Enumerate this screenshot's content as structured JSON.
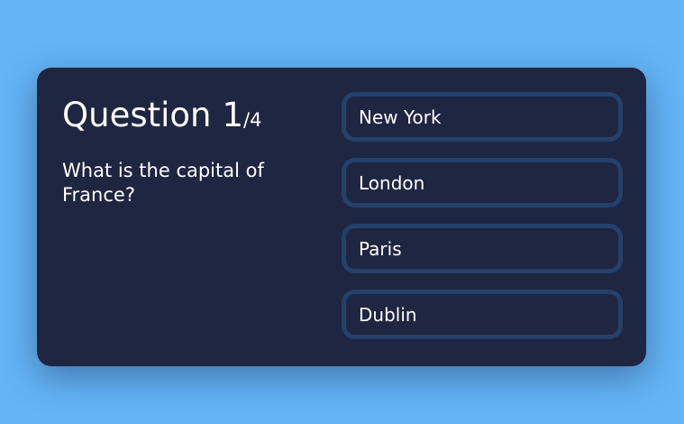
{
  "quiz": {
    "question_label": "Question",
    "current": "1",
    "total": "/4",
    "question_text": "What is the capital of France?",
    "answers": [
      {
        "label": "New York"
      },
      {
        "label": "London"
      },
      {
        "label": "Paris"
      },
      {
        "label": "Dublin"
      }
    ]
  },
  "colors": {
    "background": "#64b5f6",
    "card": "#1f2641",
    "button_border": "#24406b",
    "text": "#ffffff"
  }
}
